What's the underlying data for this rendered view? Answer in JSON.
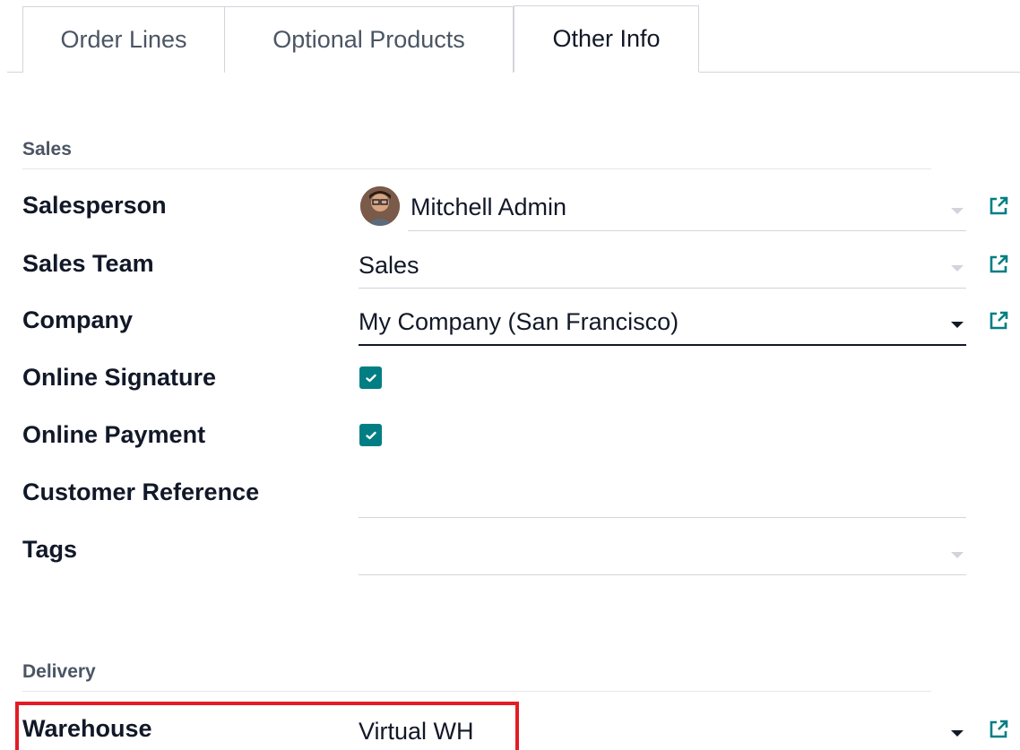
{
  "tabs": [
    {
      "label": "Order Lines"
    },
    {
      "label": "Optional Products"
    },
    {
      "label": "Other Info",
      "active": true
    }
  ],
  "sections": {
    "sales": {
      "title": "Sales",
      "fields": {
        "salesperson": {
          "label": "Salesperson",
          "value": "Mitchell Admin"
        },
        "sales_team": {
          "label": "Sales Team",
          "value": "Sales"
        },
        "company": {
          "label": "Company",
          "value": "My Company (San Francisco)"
        },
        "online_signature": {
          "label": "Online Signature",
          "checked": true
        },
        "online_payment": {
          "label": "Online Payment",
          "checked": true
        },
        "customer_reference": {
          "label": "Customer Reference",
          "value": ""
        },
        "tags": {
          "label": "Tags",
          "value": ""
        }
      }
    },
    "delivery": {
      "title": "Delivery",
      "fields": {
        "warehouse": {
          "label": "Warehouse",
          "value": "Virtual WH"
        }
      }
    }
  },
  "colors": {
    "accent": "#017e84",
    "highlight": "#e11d24",
    "active_text": "#111827",
    "muted_text": "#4b5563"
  },
  "icons": {
    "external_link": "external-link-icon",
    "dropdown": "caret-down-icon",
    "check": "check-icon"
  }
}
